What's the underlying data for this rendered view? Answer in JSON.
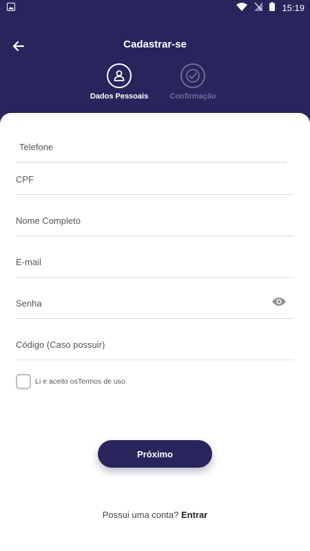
{
  "status_bar": {
    "time": "15:19",
    "icons": [
      "image-icon",
      "wifi-icon",
      "no-signal-icon",
      "battery-icon"
    ]
  },
  "header": {
    "title": "Cadastrar-se",
    "back_icon": "arrow-left-icon"
  },
  "steps": [
    {
      "label": "Dados Pessoais",
      "icon": "user-icon",
      "active": true
    },
    {
      "label": "Confirmação",
      "icon": "check-circle-icon",
      "active": false
    }
  ],
  "form": {
    "phone": {
      "placeholder": "Telefone",
      "value": ""
    },
    "cpf": {
      "placeholder": "CPF",
      "value": ""
    },
    "name": {
      "placeholder": "Nome Completo",
      "value": ""
    },
    "email": {
      "placeholder": "E-mail",
      "value": ""
    },
    "password": {
      "placeholder": "Senha",
      "value": "",
      "toggle_icon": "eye-icon"
    },
    "code": {
      "placeholder": "Código (Caso possuir)",
      "value": ""
    }
  },
  "terms": {
    "prefix": "Li e aceito os",
    "link": "Termos de uso",
    "checked": false
  },
  "next_button": {
    "label": "Próximo"
  },
  "login_prompt": {
    "text": "Possui uma conta?",
    "link": "Entrar"
  },
  "colors": {
    "primary": "#29255c",
    "inactive": "#6f6c98",
    "divider": "#dcdcdc"
  }
}
